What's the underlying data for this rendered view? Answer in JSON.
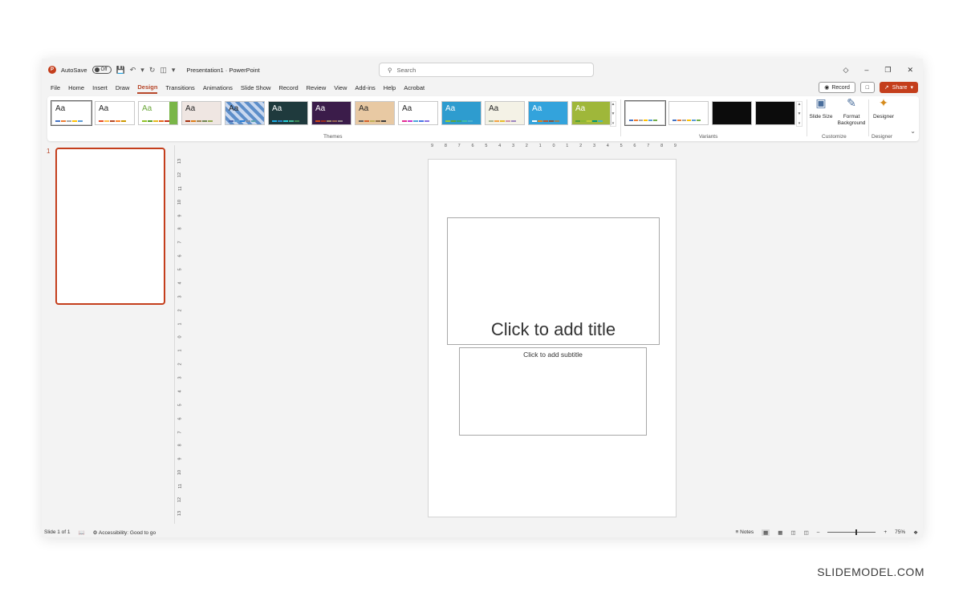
{
  "titlebar": {
    "autosave_label": "AutoSave",
    "autosave_state": "Off",
    "doc_title": "Presentation1 · PowerPoint"
  },
  "search": {
    "placeholder": "Search"
  },
  "menu": {
    "tabs": [
      "File",
      "Home",
      "Insert",
      "Draw",
      "Design",
      "Transitions",
      "Animations",
      "Slide Show",
      "Record",
      "Review",
      "View",
      "Add-ins",
      "Help",
      "Acrobat"
    ],
    "active": "Design"
  },
  "actions": {
    "record_label": "Record",
    "share_label": "Share"
  },
  "ribbon": {
    "themes_label": "Themes",
    "variants_label": "Variants",
    "customize_label": "Customize",
    "designer_group_label": "Designer",
    "slide_size_label": "Slide Size",
    "format_background_label": "Format Background",
    "designer_label": "Designer",
    "theme_glyph": "Aa"
  },
  "thumbnails": {
    "slide_number": "1"
  },
  "rulers": {
    "horizontal": [
      "9",
      "8",
      "7",
      "6",
      "5",
      "4",
      "3",
      "2",
      "1",
      "0",
      "1",
      "2",
      "3",
      "4",
      "5",
      "6",
      "7",
      "8",
      "9"
    ],
    "vertical": [
      "13",
      "12",
      "11",
      "10",
      "9",
      "8",
      "7",
      "6",
      "5",
      "4",
      "3",
      "2",
      "1",
      "0",
      "1",
      "2",
      "3",
      "4",
      "5",
      "6",
      "7",
      "8",
      "9",
      "10",
      "11",
      "12",
      "13"
    ]
  },
  "slide": {
    "title_placeholder": "Click to add title",
    "subtitle_placeholder": "Click to add subtitle"
  },
  "status": {
    "slide_info": "Slide 1 of 1",
    "accessibility": "Accessibility: Good to go",
    "notes": "Notes",
    "zoom": "75%"
  },
  "watermark": "SLIDEMODEL.COM",
  "colors": {
    "accent": "#c43e1c",
    "active_tab": "#b7472a"
  }
}
